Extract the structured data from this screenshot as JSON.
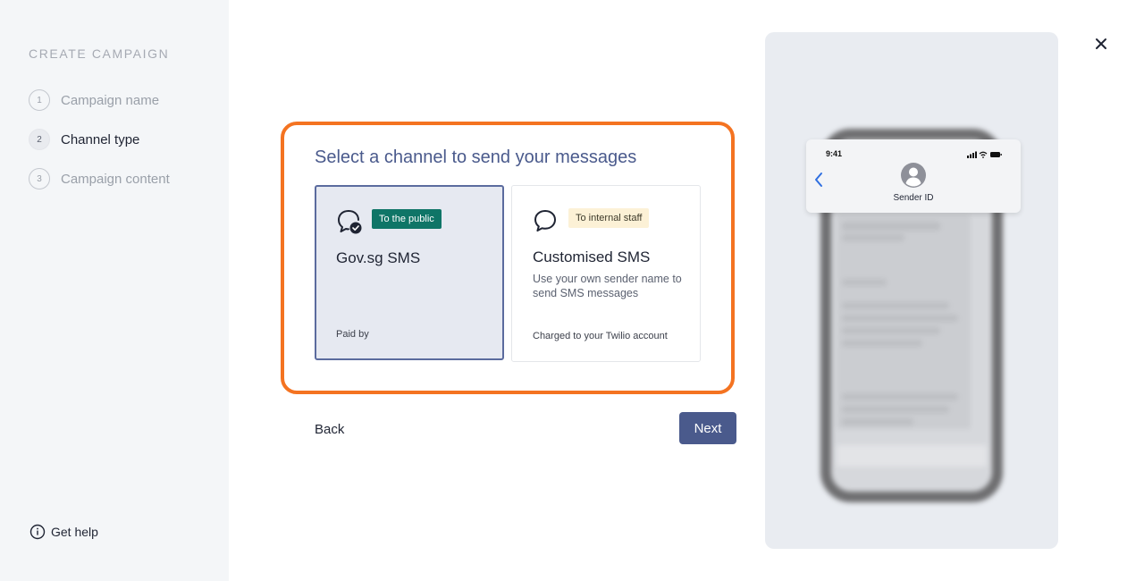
{
  "sidebar": {
    "title": "CREATE CAMPAIGN",
    "steps": [
      {
        "number": "1",
        "label": "Campaign name",
        "state": "inactive"
      },
      {
        "number": "2",
        "label": "Channel type",
        "state": "active"
      },
      {
        "number": "3",
        "label": "Campaign content",
        "state": "inactive"
      }
    ],
    "help_label": "Get help",
    "help_icon": "info-icon"
  },
  "main": {
    "heading": "Select a channel to send your messages",
    "highlight_color": "#f47321",
    "channels": [
      {
        "icon": "verified-chat-icon",
        "badge": "To the public",
        "badge_color": "#0f7567",
        "title": "Gov.sg SMS",
        "description": "",
        "footer": "Paid by",
        "selected": true
      },
      {
        "icon": "chat-bubble-icon",
        "badge": "To internal staff",
        "badge_color": "#fcf1d6",
        "title": "Customised SMS",
        "description": "Use your own sender name to send SMS messages",
        "footer": "Charged to your Twilio account",
        "selected": false
      }
    ],
    "back_label": "Back",
    "next_label": "Next",
    "accent_color": "#4a5a8c"
  },
  "preview": {
    "time": "9:41",
    "sender_label": "Sender ID",
    "back_icon": "chevron-left-icon",
    "avatar_icon": "user-avatar-icon"
  },
  "close_icon": "close-icon"
}
